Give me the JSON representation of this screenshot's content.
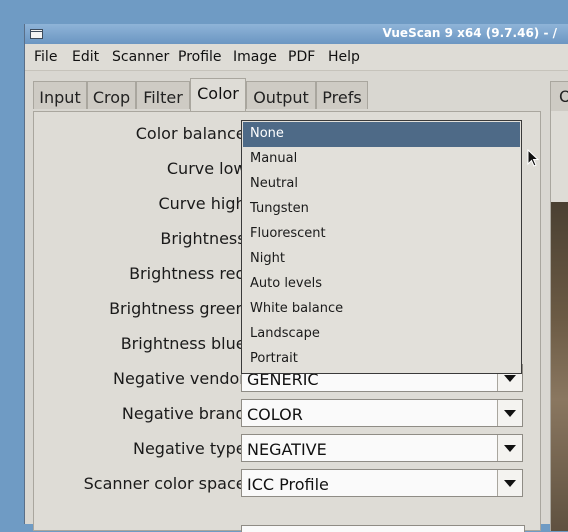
{
  "window": {
    "title": "VueScan 9 x64 (9.7.46) - /"
  },
  "menu": [
    "File",
    "Edit",
    "Scanner",
    "Profile",
    "Image",
    "PDF",
    "Help"
  ],
  "tabs": [
    "Input",
    "Crop",
    "Filter",
    "Color",
    "Output",
    "Prefs"
  ],
  "active_tab": "Color",
  "preview_tab": "O",
  "labels": {
    "color_balance": "Color balance:",
    "curve_low": "Curve low:",
    "curve_high": "Curve high:",
    "brightness": "Brightness:",
    "brightness_red": "Brightness red:",
    "brightness_green": "Brightness green:",
    "brightness_blue": "Brightness blue:",
    "negative_vendor": "Negative vendor:",
    "negative_brand": "Negative brand:",
    "negative_type": "Negative type:",
    "scanner_color_space": "Scanner color space:"
  },
  "values": {
    "negative_vendor": "GENERIC",
    "negative_brand": "COLOR",
    "negative_type": "NEGATIVE",
    "scanner_color_space": "ICC Profile"
  },
  "color_balance_options": [
    "None",
    "Manual",
    "Neutral",
    "Tungsten",
    "Fluorescent",
    "Night",
    "Auto levels",
    "White balance",
    "Landscape",
    "Portrait"
  ],
  "color_balance_selected": "None"
}
